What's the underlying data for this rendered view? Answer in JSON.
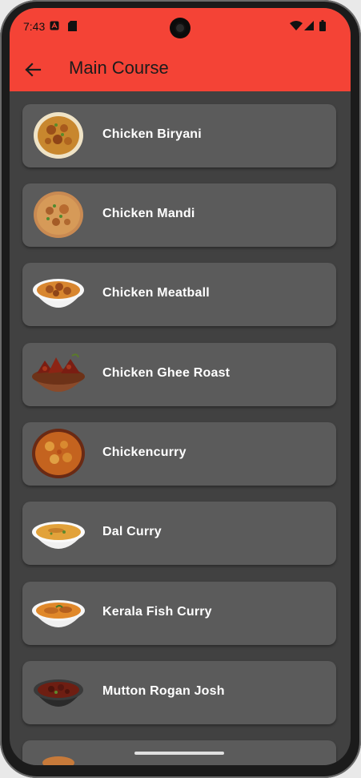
{
  "status_bar": {
    "time": "7:43",
    "icons": [
      "notification-a-icon",
      "sd-card-icon",
      "wifi-icon",
      "signal-icon",
      "battery-icon"
    ]
  },
  "app_bar": {
    "title": "Main Course",
    "back_icon": "arrow-back-icon",
    "color": "#f44336"
  },
  "dishes": [
    {
      "label": "Chicken Biryani",
      "image": "biryani-plate"
    },
    {
      "label": "Chicken Mandi",
      "image": "mandi-plate"
    },
    {
      "label": "Chicken Meatball",
      "image": "meatball-bowl"
    },
    {
      "label": "Chicken Ghee Roast",
      "image": "ghee-roast-bowl"
    },
    {
      "label": "Chickencurry",
      "image": "curry-pan"
    },
    {
      "label": "Dal Curry",
      "image": "dal-bowl"
    },
    {
      "label": "Kerala Fish Curry",
      "image": "fish-curry-bowl"
    },
    {
      "label": "Mutton Rogan Josh",
      "image": "rogan-josh-bowl"
    },
    {
      "label": "",
      "image": "partial-dish"
    }
  ]
}
